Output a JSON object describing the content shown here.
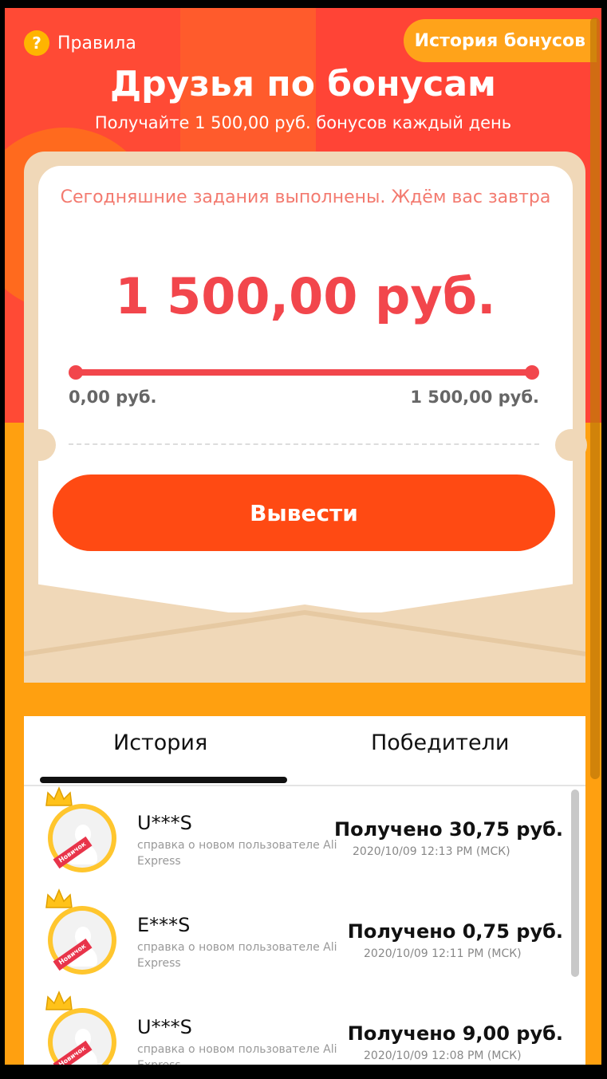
{
  "header": {
    "rules_icon": "?",
    "rules_label": "Правила",
    "history_button": "История бонусов",
    "title": "Друзья по бонусам",
    "subtitle": "Получайте 1 500,00 руб. бонусов каждый день"
  },
  "card": {
    "status_text": "Сегодняшние задания выполнены. Ждём вас завтра",
    "amount": "1 500,00 руб.",
    "progress_fraction": 1.0,
    "range_min": "0,00 руб.",
    "range_max": "1 500,00 руб.",
    "withdraw_button": "Вывести"
  },
  "tabs": [
    {
      "label": "История",
      "active": true
    },
    {
      "label": "Победители",
      "active": false
    }
  ],
  "history": [
    {
      "name": "U***S",
      "desc": "справка о новом пользователе Ali Express",
      "received": "Получено 30,75 руб.",
      "time": "2020/10/09 12:13 PM (МСК)",
      "badge": "Новичок"
    },
    {
      "name": "E***S",
      "desc": "справка о новом пользователе Ali Express",
      "received": "Получено 0,75 руб.",
      "time": "2020/10/09 12:11 PM (МСК)",
      "badge": "Новичок"
    },
    {
      "name": "U***S",
      "desc": "справка о новом пользователе Ali Express",
      "received": "Получено 9,00 руб.",
      "time": "2020/10/09 12:08 PM (МСК)",
      "badge": "Новичок"
    }
  ],
  "colors": {
    "brand_red": "#f2464c",
    "button_orange": "#ff4a13",
    "background_orange": "#ffa010"
  }
}
